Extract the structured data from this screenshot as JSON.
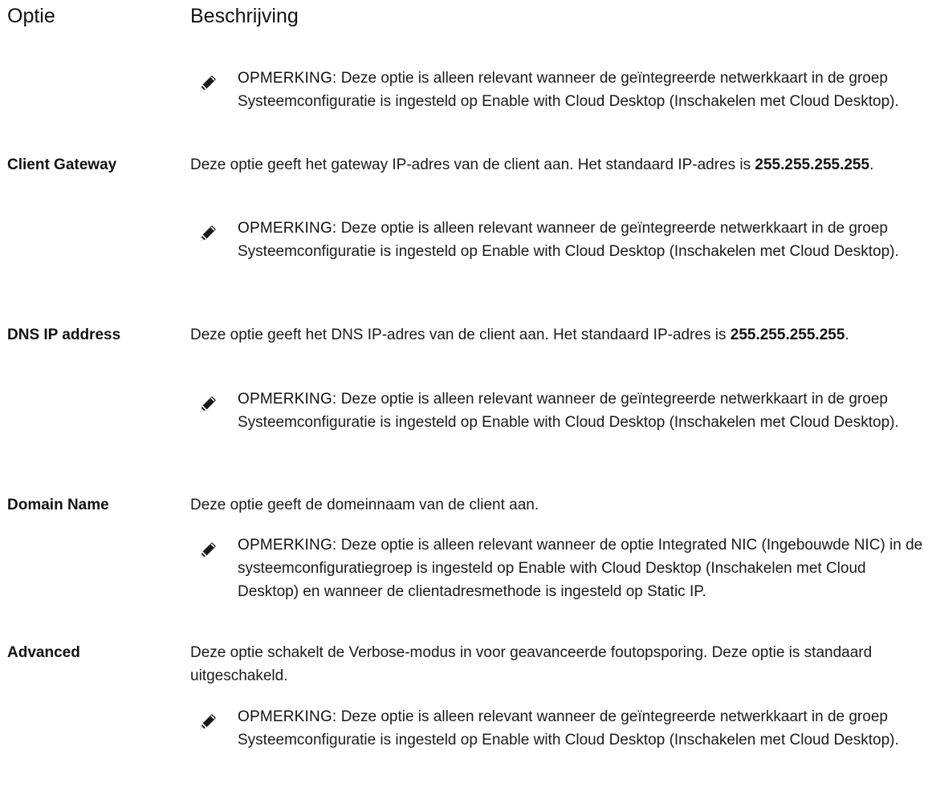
{
  "header": {
    "option": "Optie",
    "description": "Beschrijving"
  },
  "notes": {
    "label": "OPMERKING:",
    "standard": "Deze optie is alleen relevant wanneer de geïntegreerde netwerkkaart in de groep Systeemconfiguratie is ingesteld op Enable with Cloud Desktop (Inschakelen met Cloud Desktop).",
    "domain": "Deze optie is alleen relevant wanneer de optie Integrated NIC (Ingebouwde NIC) in de systeemconfiguratiegroep is ingesteld op Enable with Cloud Desktop (Inschakelen met Cloud Desktop) en wanneer de clientadresmethode is ingesteld op Static IP."
  },
  "rows": [
    {
      "label": "",
      "description": "",
      "bold_value": "",
      "suffix": ""
    },
    {
      "label": "Client Gateway",
      "description": "Deze optie geeft het gateway IP-adres van de client aan. Het standaard IP-adres is ",
      "bold_value": "255.255.255.255",
      "suffix": "."
    },
    {
      "label": "DNS IP address",
      "description": "Deze optie geeft het DNS IP-adres van de client aan. Het standaard IP-adres is ",
      "bold_value": "255.255.255.255",
      "suffix": "."
    },
    {
      "label": "Domain Name",
      "description": "Deze optie geeft de domeinnaam van de client aan.",
      "bold_value": "",
      "suffix": ""
    },
    {
      "label": "Advanced",
      "description": "Deze optie schakelt de Verbose-modus in voor geavanceerde foutopsporing. Deze optie is standaard uitgeschakeld.",
      "bold_value": "",
      "suffix": ""
    }
  ],
  "icon_color": "#1a1a1a"
}
